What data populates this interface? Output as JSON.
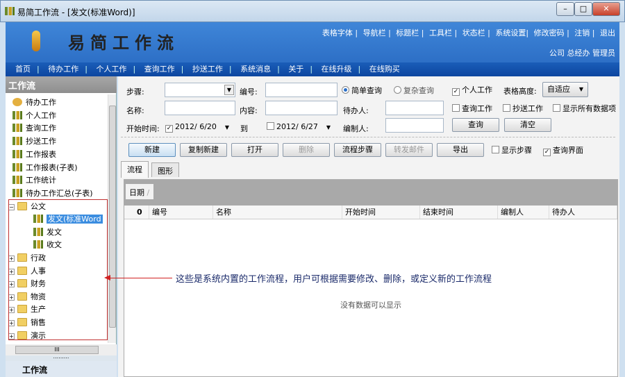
{
  "window": {
    "title": "易简工作流 - [发文(标准Word)]",
    "min": "–",
    "max": "□",
    "close": "✕"
  },
  "header": {
    "logo": "易简工作流",
    "links": [
      "表格字体",
      "导航栏",
      "标题栏",
      "工具栏",
      "状态栏",
      "系统设置",
      "修改密码",
      "注销",
      "退出"
    ],
    "user": "公司 总经办 管理员"
  },
  "nav": [
    "首页",
    "待办工作",
    "个人工作",
    "查询工作",
    "抄送工作",
    "系统消息",
    "关于",
    "在线升级",
    "在线购买"
  ],
  "sidebar": {
    "title": "工作流",
    "items": [
      "待办工作",
      "个人工作",
      "查询工作",
      "抄送工作",
      "工作报表",
      "工作报表(子表)",
      "工作统计",
      "待办工作汇总(子表)"
    ],
    "folder_open": "公文",
    "children": [
      "发文(标准Word",
      "发文",
      "收文"
    ],
    "folders": [
      "行政",
      "人事",
      "财务",
      "物资",
      "生产",
      "销售",
      "演示"
    ],
    "bottom": "工作流",
    "hscroll": "III",
    "splitter": "........."
  },
  "form": {
    "step": "步骤:",
    "number": "编号:",
    "simple": "简单查询",
    "complex": "复杂查询",
    "personal": "个人工作",
    "height_label": "表格高度:",
    "height_value": "自适应",
    "name": "名称:",
    "content": "内容:",
    "pending": "待办人:",
    "query_work": "查询工作",
    "cc_work": "抄送工作",
    "show_all": "显示所有数据项",
    "start": "开始时间:",
    "start_date": "2012/ 6/20",
    "to": "到",
    "end_date": "2012/ 6/27",
    "author": "编制人:",
    "query": "查询",
    "clear": "清空"
  },
  "toolbar": {
    "new": "新建",
    "copy_new": "复制新建",
    "open": "打开",
    "delete": "删除",
    "flow_steps": "流程步骤",
    "forward_mail": "转发邮件",
    "export": "导出",
    "show_steps": "显示步骤",
    "query_ui": "查询界面"
  },
  "tabs": [
    "流程",
    "图形"
  ],
  "grid": {
    "group": "日期",
    "columns": [
      "0",
      "编号",
      "名称",
      "开始时间",
      "结束时间",
      "编制人",
      "待办人"
    ],
    "empty": "没有数据可以显示"
  },
  "annotation": "这些是系统内置的工作流程，用户可根据需要修改、删除，或定义新的工作流程"
}
